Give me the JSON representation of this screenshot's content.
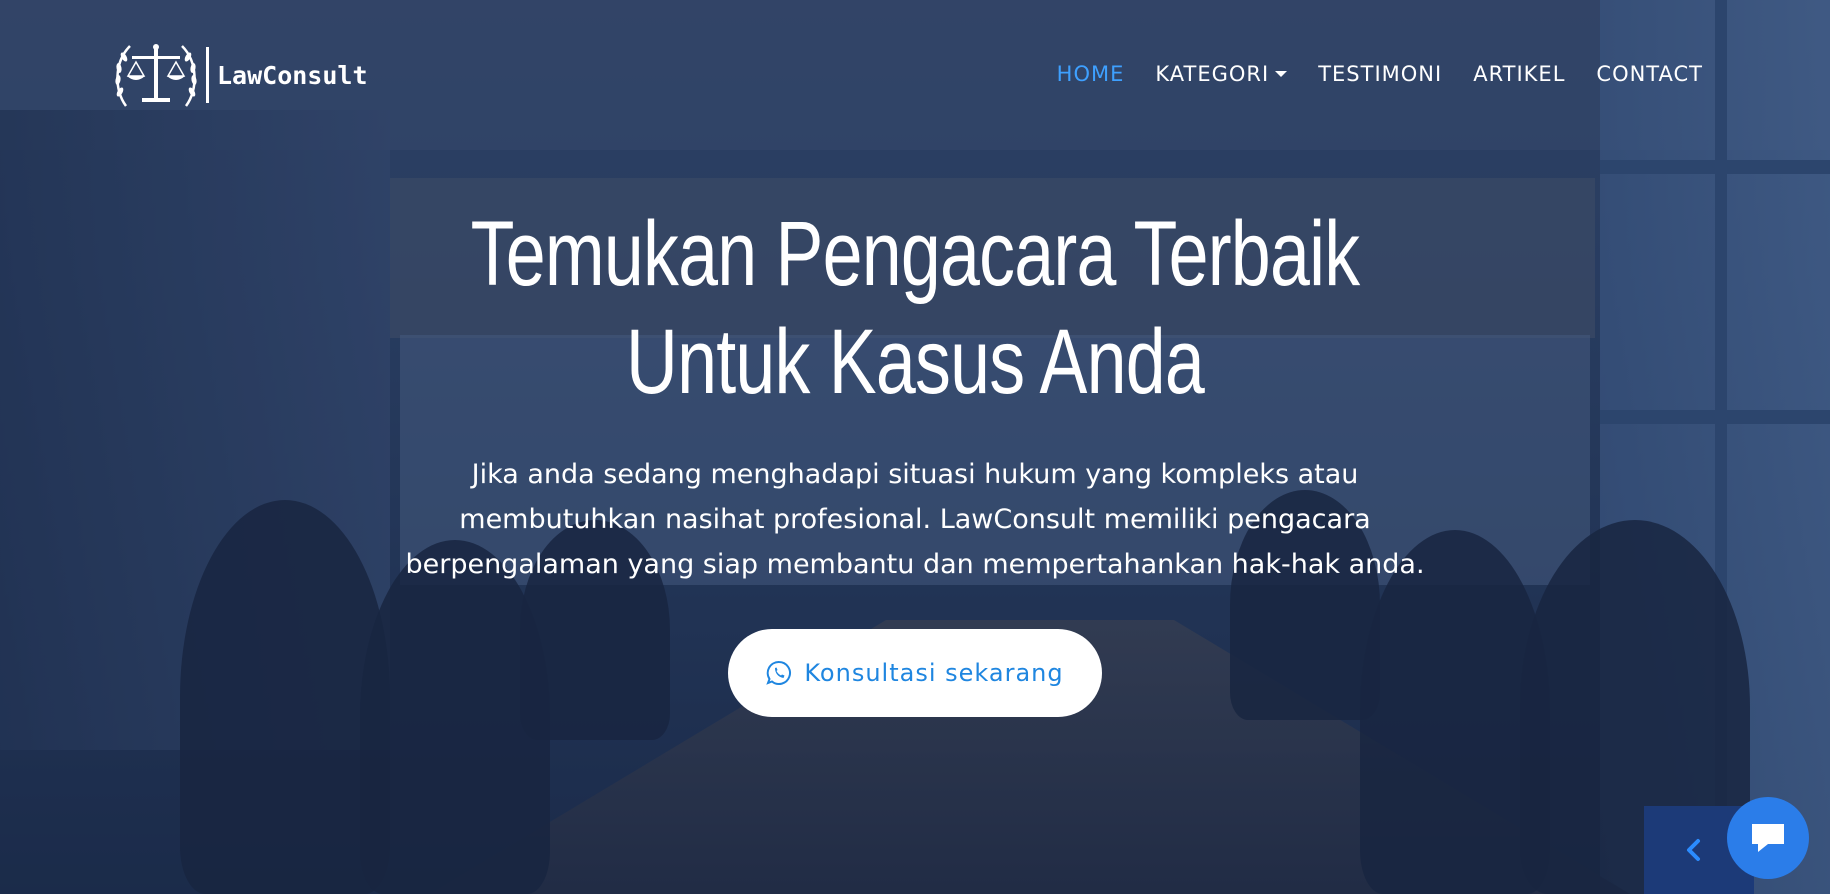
{
  "brand": {
    "name": "LawConsult",
    "logo": "scales-of-justice-laurel-logo"
  },
  "nav": {
    "items": [
      {
        "label": "HOME",
        "active": true
      },
      {
        "label": "KATEGORI",
        "dropdown": true
      },
      {
        "label": "TESTIMONI"
      },
      {
        "label": "ARTIKEL"
      },
      {
        "label": "CONTACT"
      }
    ]
  },
  "hero": {
    "title_line1": "Temukan Pengacara Terbaik",
    "title_line2": "Untuk Kasus Anda",
    "description": "Jika anda sedang menghadapi situasi hukum yang kompleks atau membutuhkan nasihat profesional. LawConsult memiliki pengacara berpengalaman yang siap membantu dan mempertahankan hak-hak anda.",
    "cta_label": "Konsultasi sekarang",
    "cta_icon": "whatsapp-icon"
  },
  "widgets": {
    "side_tab_icon": "chevron-left-icon",
    "chat_icon": "chat-bubble-icon"
  },
  "colors": {
    "accent": "#3ea0ff",
    "cta_text": "#1f86e0",
    "chat_button": "#2b7de9",
    "side_tab": "#1c3a78"
  }
}
